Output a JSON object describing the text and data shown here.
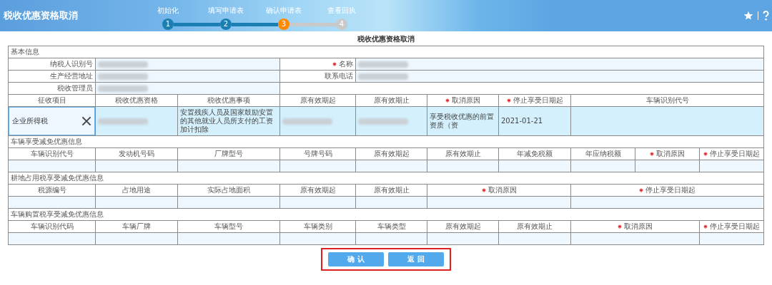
{
  "header": {
    "title": "税收优惠资格取消",
    "steps": [
      {
        "number": "1",
        "label": "初始化",
        "done": true,
        "current": false
      },
      {
        "number": "2",
        "label": "填写申请表",
        "done": true,
        "current": false
      },
      {
        "number": "3",
        "label": "确认申请表",
        "done": false,
        "current": true
      },
      {
        "number": "4",
        "label": "查看回执",
        "done": false,
        "current": false
      }
    ]
  },
  "form": {
    "title": "税收优惠资格取消",
    "sections": [
      {
        "kind": "basic",
        "heading": "基本信息",
        "fields": [
          {
            "label": "纳税人识别号",
            "required": false,
            "redacted": true
          },
          {
            "label": "名称",
            "required": true,
            "redacted": true
          },
          {
            "label": "生产经营地址",
            "required": false,
            "redacted": true
          },
          {
            "label": "联系电话",
            "required": false,
            "redacted": true
          },
          {
            "label": "税收管理员",
            "required": false,
            "redacted": true
          }
        ]
      },
      {
        "kind": "qualification",
        "columns": [
          {
            "label": "征收项目",
            "required": false
          },
          {
            "label": "税收优惠资格",
            "required": false
          },
          {
            "label": "税收优惠事项",
            "required": false
          },
          {
            "label": "原有效期起",
            "required": false
          },
          {
            "label": "原有效期止",
            "required": false
          },
          {
            "label": "取消原因",
            "required": true
          },
          {
            "label": "停止享受日期起",
            "required": true
          },
          {
            "label": "车辆识别代号",
            "required": false
          }
        ],
        "rows": [
          {
            "selected": true,
            "cells": [
              {
                "kind": "input",
                "value": "企业所得税"
              },
              {
                "kind": "text",
                "redacted": true
              },
              {
                "kind": "text",
                "value": "安置残疾人员及国家鼓励安置的其他就业人员所支付的工资加计扣除"
              },
              {
                "kind": "text",
                "redacted": true
              },
              {
                "kind": "text",
                "redacted": true
              },
              {
                "kind": "text",
                "value": "享受税收优惠的前置资质（资"
              },
              {
                "kind": "text",
                "value": "2021-01-21"
              },
              {
                "kind": "text"
              }
            ]
          }
        ]
      },
      {
        "kind": "vehicle",
        "heading": "车辆享受减免优惠信息",
        "columns": [
          {
            "label": "车辆识别代号",
            "required": false
          },
          {
            "label": "发动机号码",
            "required": false
          },
          {
            "label": "厂牌型号",
            "required": false
          },
          {
            "label": "号牌号码",
            "required": false
          },
          {
            "label": "原有效期起",
            "required": false
          },
          {
            "label": "原有效期止",
            "required": false
          },
          {
            "label": "年减免税额",
            "required": false
          },
          {
            "label": "年应纳税额",
            "required": false
          },
          {
            "label": "取消原因",
            "required": true
          },
          {
            "label": "停止享受日期起",
            "required": true
          }
        ],
        "rows": [
          {
            "selected": false
          }
        ]
      },
      {
        "kind": "land",
        "heading": "耕地占用税享受减免优惠信息",
        "columns": [
          {
            "label": "税源编号",
            "required": false
          },
          {
            "label": "占地用途",
            "required": false
          },
          {
            "label": "实际占地面积",
            "required": false
          },
          {
            "label": "原有效期起",
            "required": false
          },
          {
            "label": "原有效期止",
            "required": false
          },
          {
            "label": "取消原因",
            "required": true
          },
          {
            "label": "停止享受日期起",
            "required": true
          }
        ],
        "rows": [
          {
            "selected": false
          }
        ]
      },
      {
        "kind": "purchase",
        "heading": "车辆购置税享受减免优惠信息",
        "columns": [
          {
            "label": "车辆识别代码",
            "required": false
          },
          {
            "label": "车辆厂牌",
            "required": false
          },
          {
            "label": "车辆型号",
            "required": false
          },
          {
            "label": "车辆类别",
            "required": false
          },
          {
            "label": "车辆类型",
            "required": false
          },
          {
            "label": "原有效期起",
            "required": false
          },
          {
            "label": "原有效期止",
            "required": false
          },
          {
            "label": "取消原因",
            "required": true
          },
          {
            "label": "停止享受日期起",
            "required": true
          }
        ],
        "rows": [
          {
            "selected": false
          }
        ]
      }
    ]
  },
  "actions": {
    "highlighted": true,
    "buttons": [
      {
        "label": "确 认"
      },
      {
        "label": "返 回"
      }
    ]
  }
}
